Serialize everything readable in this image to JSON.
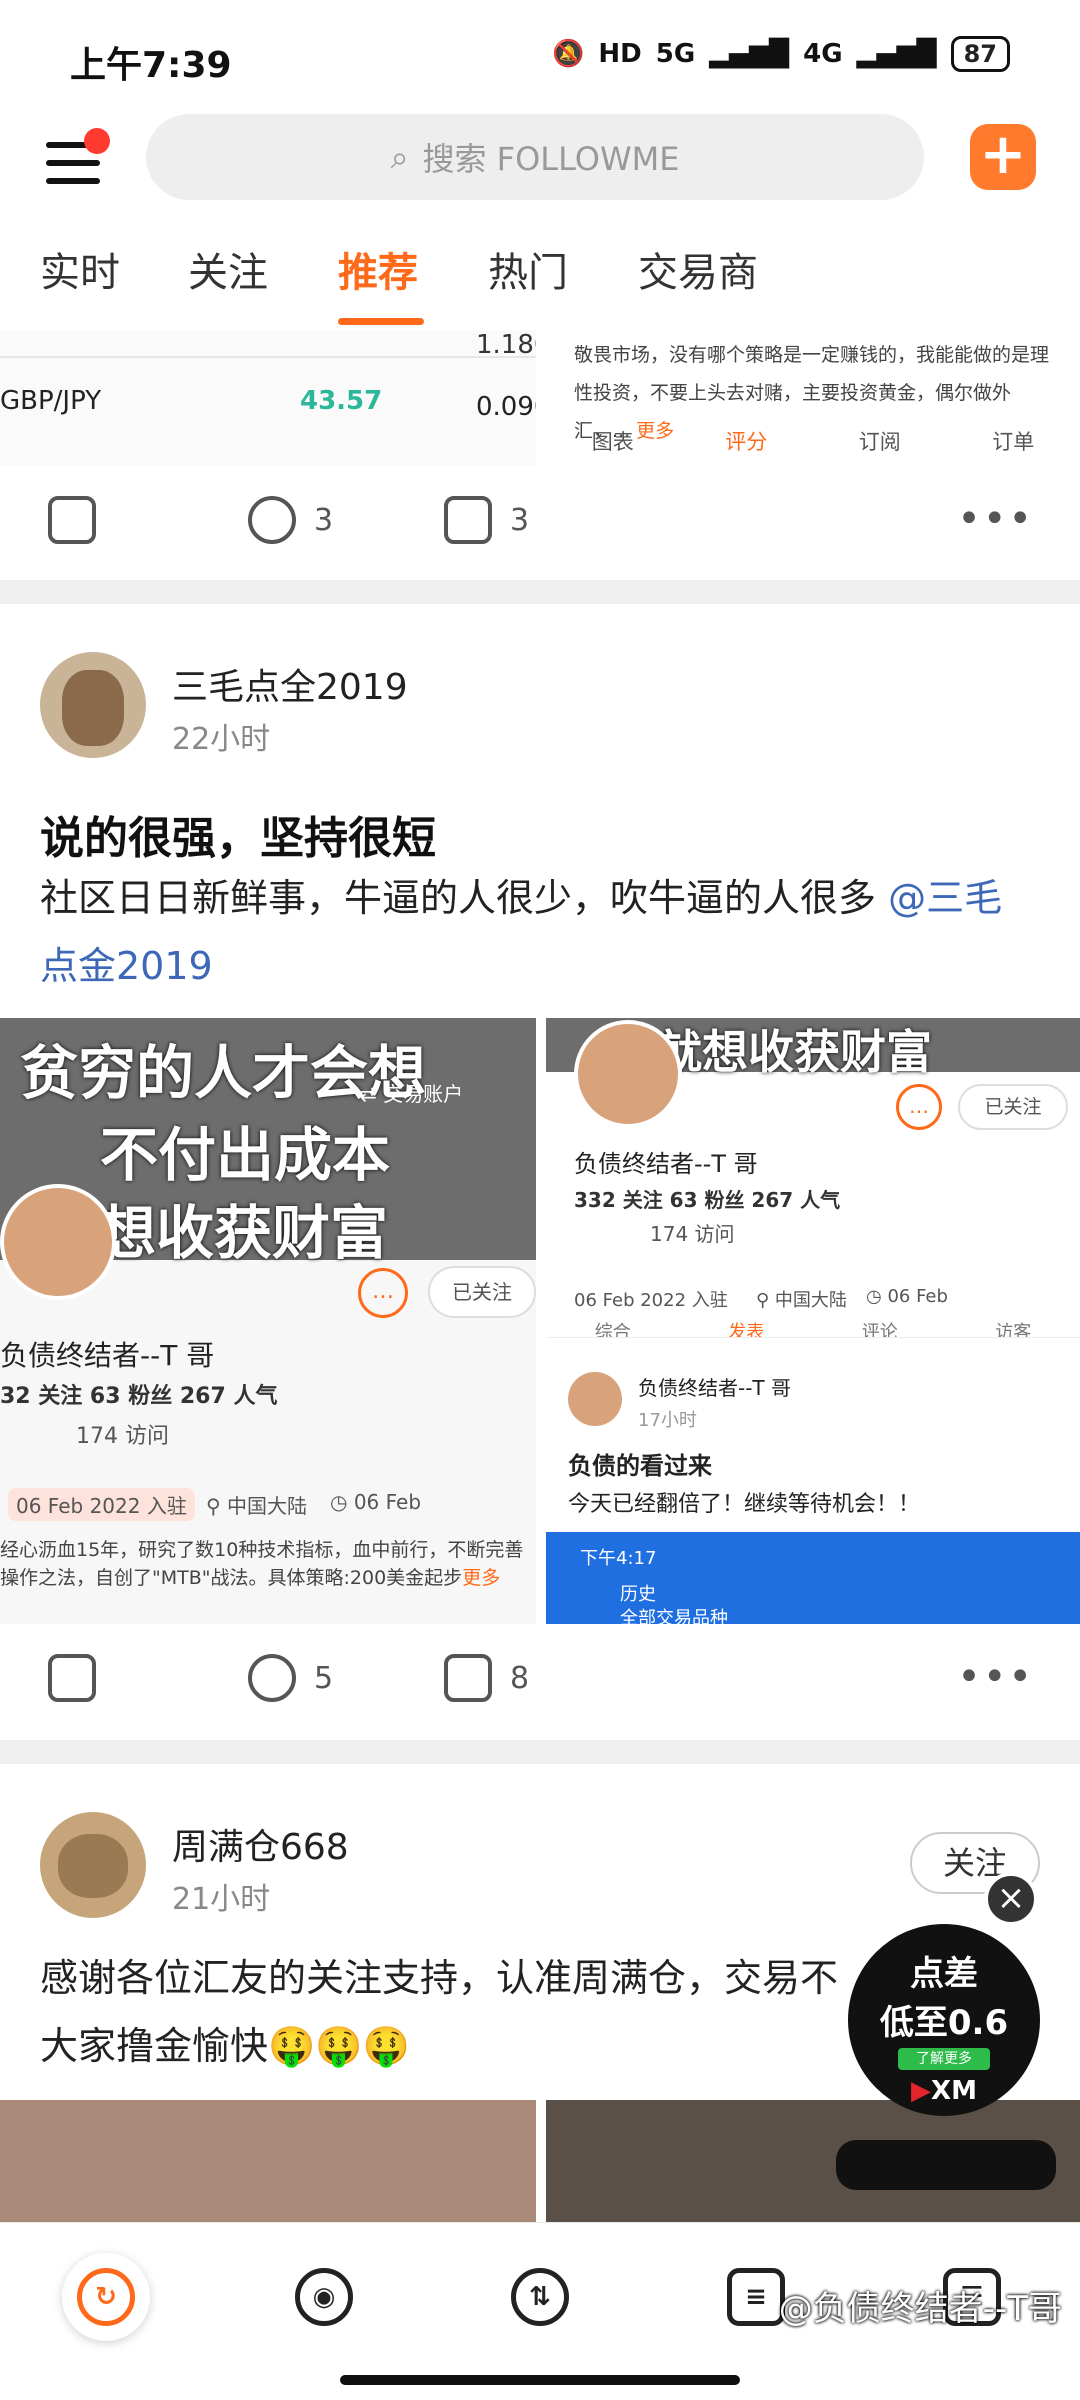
{
  "status": {
    "time": "上午7:39",
    "battery": "87",
    "net1": "5G",
    "net2": "4G",
    "hd": "HD"
  },
  "search": {
    "placeholder": "搜索 FOLLOWME"
  },
  "tabs": [
    {
      "label": "实时"
    },
    {
      "label": "关注"
    },
    {
      "label": "推荐"
    },
    {
      "label": "热门"
    },
    {
      "label": "交易商"
    }
  ],
  "post0": {
    "img_left": {
      "row1_symbol": "GBP/JPY",
      "row1_val": "43.57",
      "row1_val2": "0.090",
      "row0_val2": "1.180"
    },
    "img_right": {
      "text": "敬畏市场，没有哪个策略是一定赚钱的，我能能做的是理性投资，不要上头去对赌，主要投资黄金，偶尔做外汇，...",
      "more": "更多",
      "tabs": [
        "图表",
        "评分",
        "订阅",
        "订单"
      ]
    },
    "comments": "3",
    "likes": "3"
  },
  "post1": {
    "username": "三毛点全2019",
    "time": "22小时",
    "title": "说的很强，坚持很短",
    "text": "社区日日新鲜事，牛逼的人很少，吹牛逼的人很多",
    "mention": "@三毛点金2019",
    "img_left": {
      "meme1": "贫穷的人才会想",
      "meme2": "不付出成本",
      "meme3": "就想收获财富",
      "trade_account": "交易账户",
      "follow": "已关注",
      "name": "负债终结者--T 哥",
      "stats": "32 关注  63 粉丝  267 人气",
      "visits": "174 访问",
      "joined": "06 Feb 2022 入驻",
      "region": "中国大陆",
      "date2": "06 Feb",
      "bio": "经心沥血15年，研究了数10种技术指标，血中前行，不断完善操作之法，自创了\"MTB\"战法。具体策略:200美金起步",
      "more": "更多"
    },
    "img_right": {
      "meme": "就想收获财富",
      "follow": "已关注",
      "name": "负债终结者--T 哥",
      "stats": "332 关注  63 粉丝  267 人气",
      "visits": "174 访问",
      "joined": "06 Feb 2022 入驻",
      "region": "中国大陆",
      "date2": "06 Feb",
      "tabs": [
        "综合",
        "发表",
        "评论",
        "访客"
      ],
      "post_user": "负债终结者--T 哥",
      "post_time": "17小时",
      "post_title": "负债的看过来",
      "post_text": "今天已经翻倍了！继续等待机会！！",
      "phone_time": "下午4:17",
      "history": "历史",
      "all_products": "全部交易品种"
    },
    "comments": "5",
    "likes": "8"
  },
  "post2": {
    "username": "周满仓668",
    "time": "21小时",
    "follow": "关注",
    "text_line1": "感谢各位汇友的关注支持，认准周满仓，交易不",
    "text_line2": "大家撸金愉快🤑🤑🤑"
  },
  "ad": {
    "line1": "点差",
    "line2": "低至0.6",
    "cta": "了解更多",
    "brand": "XM",
    "close": "×"
  },
  "watermark": "@负债终结者--T哥",
  "colors": {
    "accent": "#ff6a1a",
    "mention": "#3d68b8",
    "add_button": "#ff7a2d"
  }
}
